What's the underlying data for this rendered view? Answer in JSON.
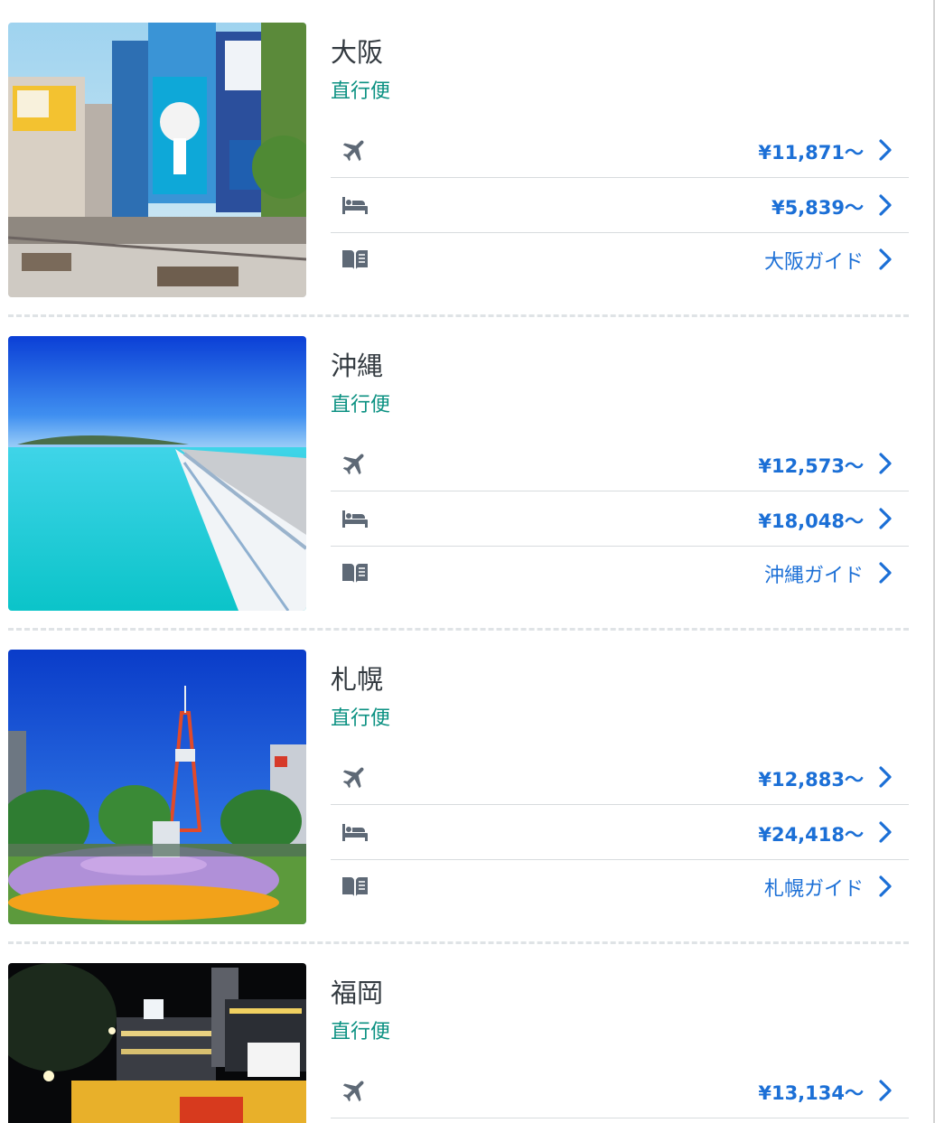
{
  "destinations": [
    {
      "name": "大阪",
      "direct_label": "直行便",
      "flight_price": "¥11,871〜",
      "hotel_price": "¥5,839〜",
      "guide_label": "大阪ガイド"
    },
    {
      "name": "沖縄",
      "direct_label": "直行便",
      "flight_price": "¥12,573〜",
      "hotel_price": "¥18,048〜",
      "guide_label": "沖縄ガイド"
    },
    {
      "name": "札幌",
      "direct_label": "直行便",
      "flight_price": "¥12,883〜",
      "hotel_price": "¥24,418〜",
      "guide_label": "札幌ガイド"
    },
    {
      "name": "福岡",
      "direct_label": "直行便",
      "flight_price": "¥13,134〜"
    }
  ],
  "icons": {
    "flight": "airplane-icon",
    "hotel": "bed-icon",
    "guide": "book-icon",
    "arrow": "chevron-right-icon"
  },
  "colors": {
    "price_text": "#1b6fd6",
    "direct_text": "#0b9182",
    "icon": "#5e6976",
    "title": "#333a40"
  }
}
